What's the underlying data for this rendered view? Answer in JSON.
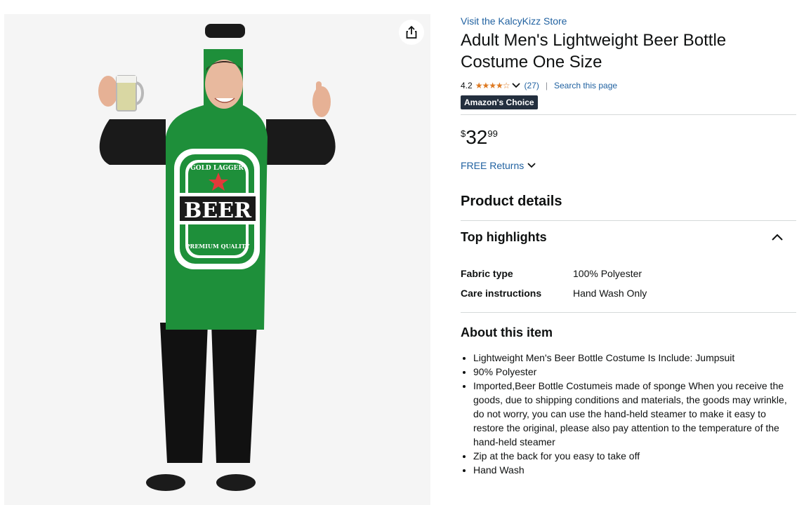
{
  "store_link": "Visit the KalcyKizz Store",
  "title_line1": "Adult Men's Lightweight Beer Bottle",
  "title_line2": "Costume One Size",
  "rating": {
    "value": "4.2",
    "stars_filled": 4,
    "stars_total": 5,
    "count": "(27)",
    "search_link": "Search this page"
  },
  "badge": "Amazon's Choice",
  "price": {
    "symbol": "$",
    "whole": "32",
    "fraction": "99"
  },
  "returns": "FREE Returns",
  "product_details_heading": "Product details",
  "top_highlights_heading": "Top highlights",
  "specs": [
    {
      "key": "Fabric type",
      "value": "100% Polyester"
    },
    {
      "key": "Care instructions",
      "value": "Hand Wash Only"
    }
  ],
  "about_heading": "About this item",
  "bullets": [
    "Lightweight Men's Beer Bottle Costume Is Include: Jumpsuit",
    "90% Polyester",
    "Imported,Beer Bottle Costumeis made of sponge When you receive the goods, due to shipping conditions and materials, the goods may wrinkle, do not worry, you can use the hand-held steamer to make it easy to restore the original, please also pay attention to the temperature of the hand-held steamer",
    "Zip at the back for you easy to take off",
    "Hand Wash"
  ],
  "product_image": {
    "label_top": "GOLD LAGGER",
    "label_main": "BEER",
    "label_bottom": "PREMIUM QUALITY"
  },
  "colors": {
    "link": "#2162a1",
    "star": "#de7921",
    "badge_bg": "#232f3e",
    "bottle_green": "#1e8f3a"
  }
}
